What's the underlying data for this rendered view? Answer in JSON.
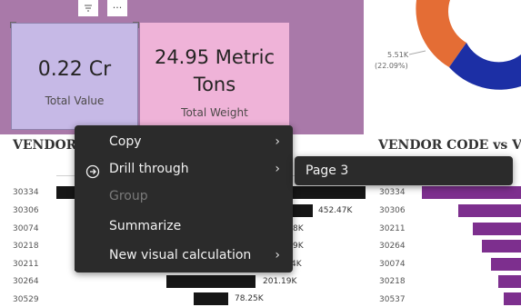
{
  "kpi_cards": [
    {
      "value": "0.22 Cr",
      "label": "Total Value"
    },
    {
      "value_line1": "24.95 Metric",
      "value_line2": "Tons",
      "label": "Total Weight"
    }
  ],
  "visual_header": {
    "filter_icon": "filter-icon",
    "more_icon": "more-options-icon",
    "more_glyph": "···"
  },
  "donut": {
    "label_value": "5.51K",
    "label_percent": "(22.09%)",
    "colors": {
      "orange": "#e46d35",
      "blue": "#1c2fa5"
    }
  },
  "left_chart": {
    "title": "VENDOR",
    "rows": [
      "30334",
      "30306",
      "30074",
      "30218",
      "30211",
      "30264",
      "30529"
    ],
    "visible_value_labels": [
      "452.47K",
      "8K",
      "9K",
      "4K",
      "201.19K",
      "78.25K"
    ],
    "bar_color": "#161616"
  },
  "right_chart": {
    "title": "VENDOR CODE vs V",
    "rows": [
      "30334",
      "30306",
      "30211",
      "30264",
      "30074",
      "30218",
      "30537"
    ],
    "bar_color": "#7d2f8e"
  },
  "context_menu": {
    "items": [
      {
        "label": "Copy",
        "has_submenu": true,
        "disabled": false
      },
      {
        "label": "Drill through",
        "has_submenu": true,
        "disabled": false,
        "icon": "drill-through-icon"
      },
      {
        "label": "Group",
        "has_submenu": false,
        "disabled": true
      },
      {
        "label": "Summarize",
        "has_submenu": false,
        "disabled": false
      },
      {
        "label": "New visual calculation",
        "has_submenu": true,
        "disabled": false
      }
    ],
    "chevron_glyph": "›",
    "drill_icon_glyph": "➔"
  },
  "submenu": {
    "items": [
      {
        "label": "Page 3"
      }
    ]
  }
}
